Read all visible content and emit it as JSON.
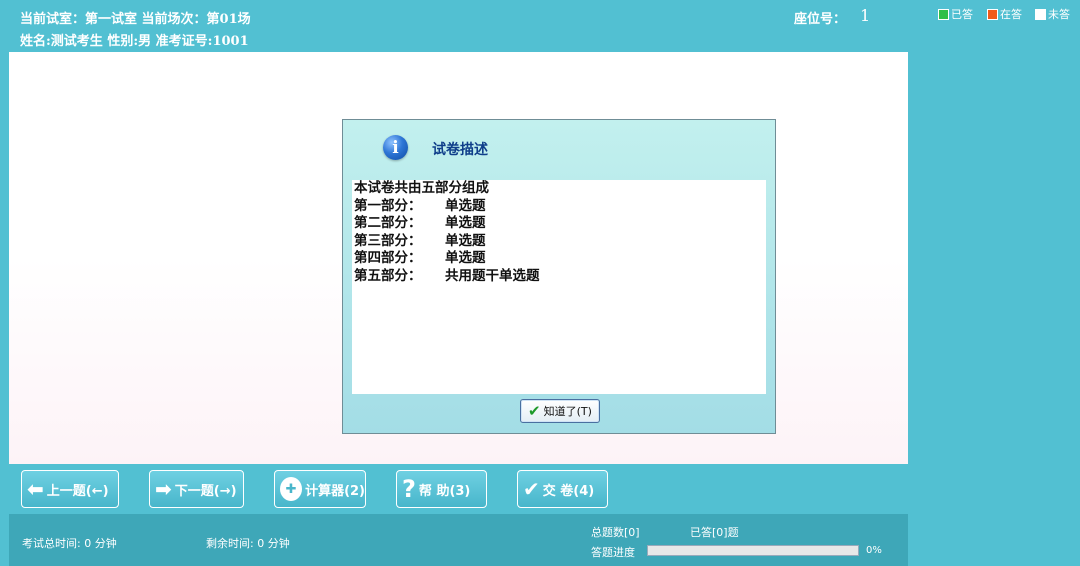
{
  "header": {
    "room_line": "当前试室：第一试室 当前场次：第01场",
    "candidate_line": "姓名:测试考生   性别:男    准考证号:1001",
    "seat_label": "座位号：",
    "seat_value": "1"
  },
  "legend": {
    "answered": {
      "label": "已答",
      "color": "#2fbf49"
    },
    "current": {
      "label": "在答",
      "color": "#f05a1a"
    },
    "unanswered": {
      "label": "未答",
      "color": "#ffffff"
    }
  },
  "dialog": {
    "icon": "info-icon",
    "title": "试卷描述",
    "intro": "本试卷共由五部分组成",
    "parts": [
      {
        "label": "第一部分：",
        "type": "单选题"
      },
      {
        "label": "第二部分：",
        "type": "单选题"
      },
      {
        "label": "第三部分：",
        "type": "单选题"
      },
      {
        "label": "第四部分：",
        "type": "单选题"
      },
      {
        "label": "第五部分：",
        "type": "共用题干单选题"
      }
    ],
    "ok_label": "知道了(T)"
  },
  "nav": {
    "prev_label": "上一题(←)",
    "next_label": "下一题(→)",
    "calc_label": "计算器(2)",
    "help_label": "帮  助(3)",
    "submit_label": "交  卷(4)"
  },
  "status": {
    "total_time": "考试总时间:  0 分钟",
    "remaining_time": "剩余时间:  0 分钟",
    "total_questions": "总题数[0]",
    "answered": "已答[0]题",
    "progress_label": "答题进度",
    "progress_value": 0,
    "progress_text": "0%"
  }
}
